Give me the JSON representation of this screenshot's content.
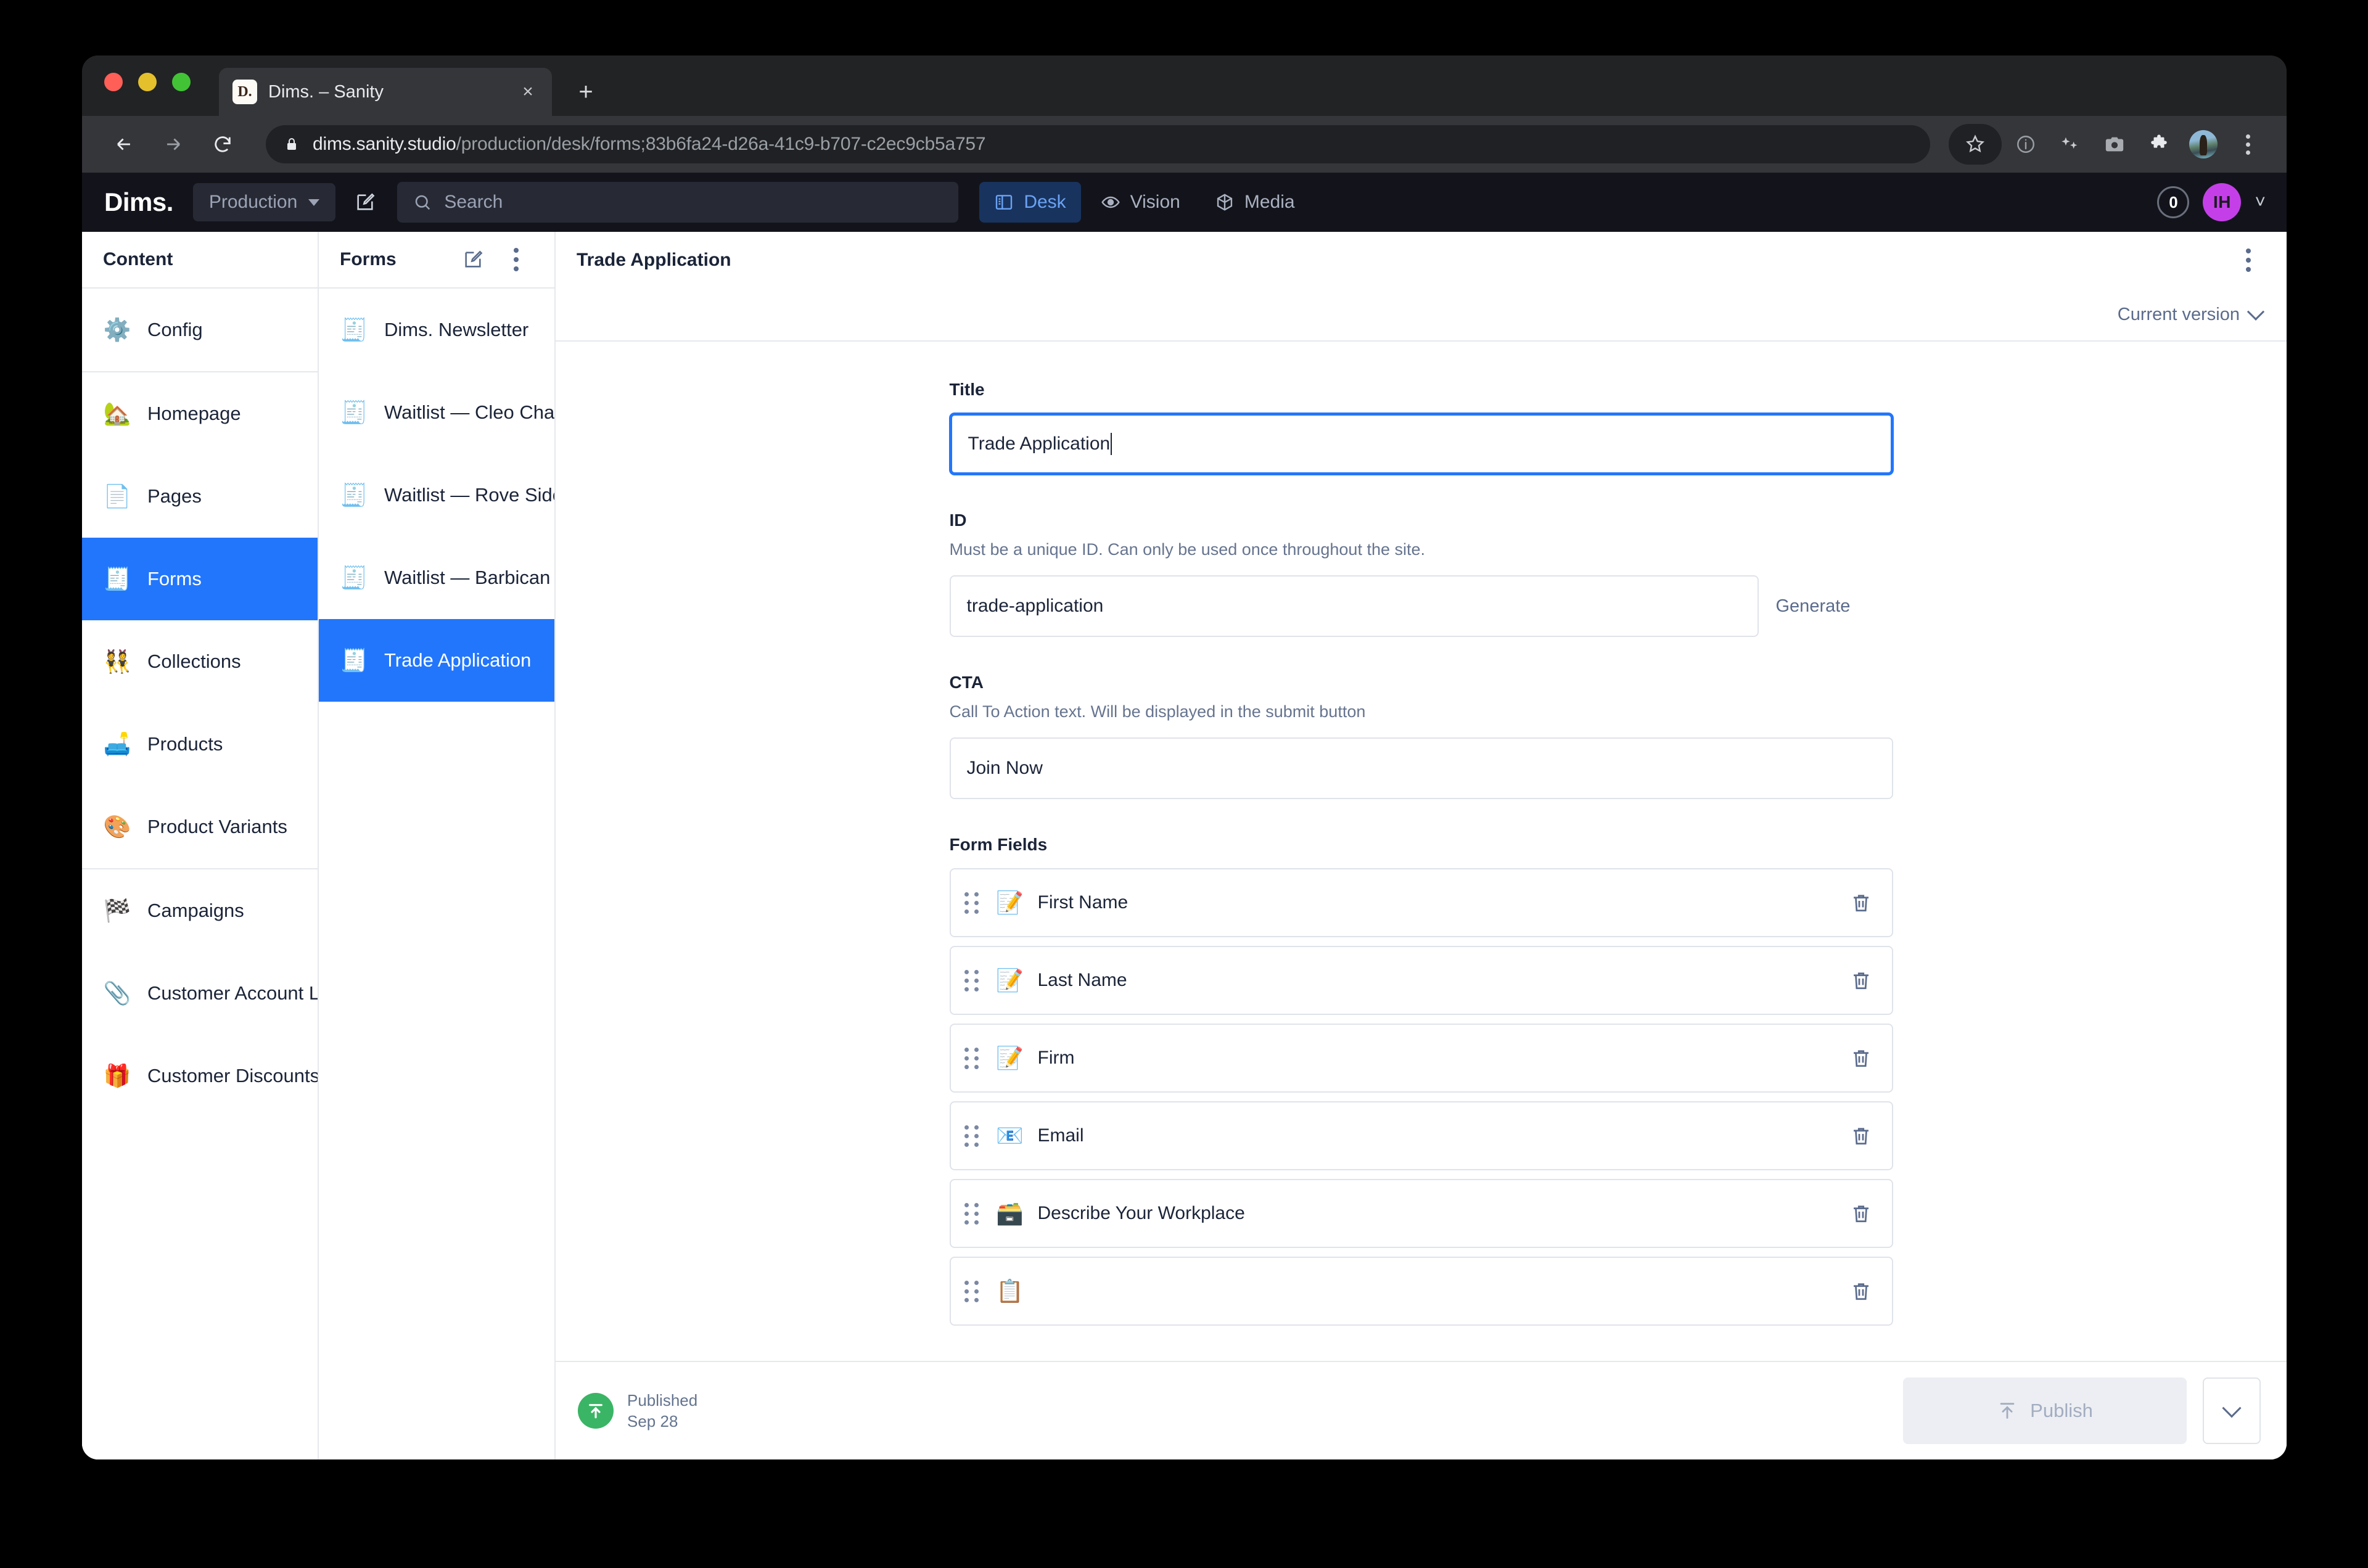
{
  "browser": {
    "tab": {
      "title": "Dims. – Sanity",
      "favicon_text": "D.",
      "close_label": "×",
      "new_tab_label": "+"
    },
    "address": {
      "host": "dims.sanity.studio",
      "path": "/production/desk/forms;83b6fa24-d26a-41c9-b707-c2ec9cb5a757",
      "lock_icon": "lock-icon"
    },
    "toolbar_icons": [
      "back-icon",
      "forward-icon",
      "reload-icon",
      "bookmark-star-icon",
      "info-circle-icon",
      "sparkle-icon",
      "screenshot-camera-icon",
      "extensions-puzzle-icon",
      "profile-avatar",
      "browser-menu-icon"
    ]
  },
  "app_header": {
    "brand": "Dims.",
    "workspace": "Production",
    "compose_icon": "compose-icon",
    "search": {
      "placeholder": "Search",
      "icon": "search-icon"
    },
    "nav": [
      {
        "label": "Desk",
        "icon": "desk-icon",
        "active": true
      },
      {
        "label": "Vision",
        "icon": "eye-icon",
        "active": false
      },
      {
        "label": "Media",
        "icon": "cube-icon",
        "active": false
      }
    ],
    "badge_count": "0",
    "user_initials": "IH"
  },
  "content_pane": {
    "title": "Content",
    "items": [
      {
        "label": "Config",
        "emoji": "⚙️",
        "icon": "gear-icon",
        "selected": false,
        "sep_after": true
      },
      {
        "label": "Homepage",
        "emoji": "🏡",
        "icon": "house-icon",
        "selected": false
      },
      {
        "label": "Pages",
        "emoji": "📄",
        "icon": "page-icon",
        "selected": false
      },
      {
        "label": "Forms",
        "emoji": "🧾",
        "icon": "receipt-icon",
        "selected": true
      },
      {
        "label": "Collections",
        "emoji": "👯",
        "icon": "people-icon",
        "selected": false
      },
      {
        "label": "Products",
        "emoji": "🛋️",
        "icon": "couch-icon",
        "selected": false
      },
      {
        "label": "Product Variants",
        "emoji": "🎨",
        "icon": "palette-icon",
        "selected": false,
        "sep_after": true
      },
      {
        "label": "Campaigns",
        "emoji": "🏁",
        "icon": "flag-icon",
        "selected": false
      },
      {
        "label": "Customer Account Links",
        "emoji": "📎",
        "icon": "paperclip-icon",
        "selected": false
      },
      {
        "label": "Customer Discounts",
        "emoji": "🎁",
        "icon": "gift-icon",
        "selected": false
      }
    ]
  },
  "forms_pane": {
    "title": "Forms",
    "compose_icon": "compose-icon",
    "menu_icon": "kebab-menu-icon",
    "items": [
      {
        "label": "Dims. Newsletter",
        "emoji": "🧾",
        "selected": false
      },
      {
        "label": "Waitlist — Cleo Chair",
        "emoji": "🧾",
        "selected": false
      },
      {
        "label": "Waitlist — Rove Side Table",
        "emoji": "🧾",
        "selected": false
      },
      {
        "label": "Waitlist — Barbican Trolley II",
        "emoji": "🧾",
        "selected": false
      },
      {
        "label": "Trade Application",
        "emoji": "🧾",
        "selected": true
      }
    ]
  },
  "document": {
    "title": "Trade Application",
    "menu_icon": "kebab-menu-icon",
    "version_label": "Current version",
    "fields": {
      "title": {
        "label": "Title",
        "value": "Trade Application",
        "focused": true
      },
      "id": {
        "label": "ID",
        "description": "Must be a unique ID. Can only be used once throughout the site.",
        "value": "trade-application",
        "action_label": "Generate"
      },
      "cta": {
        "label": "CTA",
        "description": "Call To Action text. Will be displayed in the submit button",
        "value": "Join Now"
      },
      "form_fields": {
        "label": "Form Fields",
        "rows": [
          {
            "label": "First Name",
            "emoji": "📝",
            "icon": "memo-icon"
          },
          {
            "label": "Last Name",
            "emoji": "📝",
            "icon": "memo-icon"
          },
          {
            "label": "Firm",
            "emoji": "📝",
            "icon": "memo-icon"
          },
          {
            "label": "Email",
            "emoji": "📧",
            "icon": "email-icon"
          },
          {
            "label": "Describe Your Workplace",
            "emoji": "🗃️",
            "icon": "card-file-box-icon"
          },
          {
            "label": "",
            "emoji": "📋",
            "icon": "clipboard-icon"
          }
        ]
      }
    },
    "footer": {
      "status_label": "Published",
      "status_date": "Sep 28",
      "publish_button": "Publish",
      "publish_icon": "publish-arrow-icon",
      "publish_disabled": true
    }
  },
  "colors": {
    "accent_blue": "#2276fc",
    "header_bg": "#13141b",
    "published_green": "#3ab565",
    "avatar_magenta": "#c53fe8"
  }
}
